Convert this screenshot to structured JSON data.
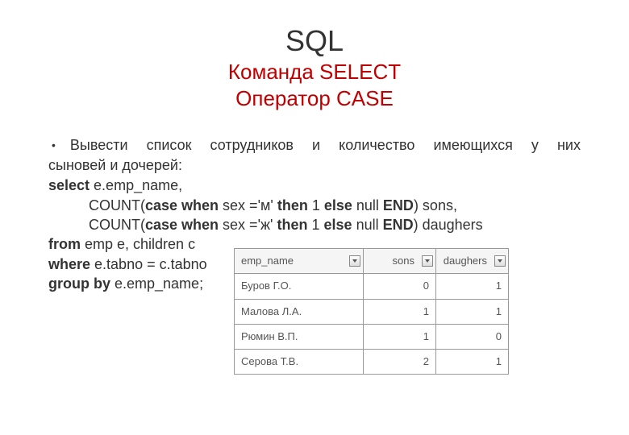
{
  "title": {
    "main": "SQL",
    "sub1": "Команда SELECT",
    "sub2": "Оператор CASE"
  },
  "bullet": {
    "line1": "Вывести список сотрудников и количество имеющихся у них",
    "line2": "сыновей и дочерей:"
  },
  "code": {
    "l1_select": "select",
    "l1_rest": " e.emp_name,",
    "l2_pre": "COUNT(",
    "l2_case": "case when",
    "l2_mid": " sex ='м' ",
    "l2_then": "then",
    "l2_one": " 1 ",
    "l2_else": "else",
    "l2_null": " null ",
    "l2_end": "END",
    "l2_close": ") sons,",
    "l3_mid": " sex ='ж' ",
    "l3_close": ") daughers",
    "l4_from": "from",
    "l4_rest": " emp e, children c",
    "l5_where": "where",
    "l5_rest": " e.tabno = c.tabno",
    "l6_group": "group by",
    "l6_rest": " e.emp_name;"
  },
  "table": {
    "headers": {
      "c1": "emp_name",
      "c2": "sons",
      "c3": "daughers"
    },
    "rows": [
      {
        "name": "Буров Г.О.",
        "sons": "0",
        "daughers": "1"
      },
      {
        "name": "Малова Л.А.",
        "sons": "1",
        "daughers": "1"
      },
      {
        "name": "Рюмин В.П.",
        "sons": "1",
        "daughers": "0"
      },
      {
        "name": "Серова Т.В.",
        "sons": "2",
        "daughers": "1"
      }
    ]
  },
  "chart_data": {
    "type": "table",
    "title": "SQL CASE operator result",
    "columns": [
      "emp_name",
      "sons",
      "daughers"
    ],
    "rows": [
      [
        "Буров Г.О.",
        0,
        1
      ],
      [
        "Малова Л.А.",
        1,
        1
      ],
      [
        "Рюмин В.П.",
        1,
        0
      ],
      [
        "Серова Т.В.",
        2,
        1
      ]
    ]
  }
}
